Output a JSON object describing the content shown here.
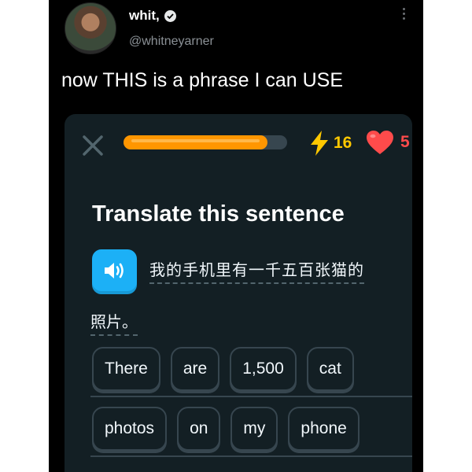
{
  "tweet": {
    "display_name": "whit,",
    "handle": "@whitneyarner",
    "text": "now THIS is a phrase I can USE"
  },
  "lesson": {
    "progress": 0.88,
    "streak_count": "16",
    "hearts_count": "5",
    "heading": "Translate this sentence",
    "prompt_line1": "我的手机里有一千五百张猫的",
    "prompt_line2": "照片。",
    "answer_row1": [
      "There",
      "are",
      "1,500",
      "cat"
    ],
    "answer_row2": [
      "photos",
      "on",
      "my",
      "phone"
    ]
  },
  "colors": {
    "card_bg": "#131f24",
    "progress": "#ff9600",
    "speaker": "#1cb0f6",
    "heart": "#ff4b4b",
    "lightning": "#ffc800"
  },
  "icons": [
    "avatar",
    "verified-badge-icon",
    "more-options-icon",
    "close-icon",
    "lightning-icon",
    "heart-icon",
    "speaker-icon"
  ]
}
